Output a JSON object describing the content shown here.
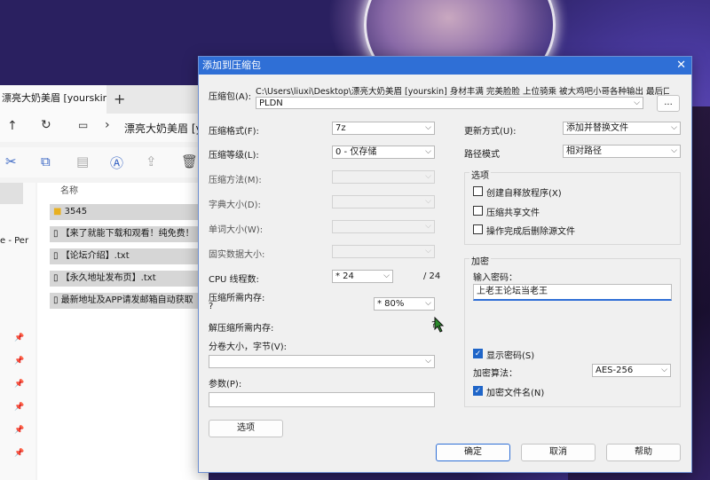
{
  "explorer": {
    "tab_title": "漂亮大奶美眉 [yourskin] 身材丰",
    "address": "漂亮大奶美眉 [y",
    "side_text": "e - Per",
    "column_name": "名称",
    "files": [
      "3545",
      "【来了就能下载和观看！纯免费！",
      "【论坛介绍】.txt",
      "【永久地址发布页】.txt",
      "最新地址及APP请发邮箱自动获取"
    ]
  },
  "dialog": {
    "title": "添加到压缩包",
    "close_glyph": "✕",
    "archive_label": "压缩包(A):",
    "archive_path": "C:\\Users\\liuxi\\Desktop\\漂亮大奶美眉 [yourskin] 身材丰满 完美脸脸 上位骑乘 被大鸡吧小哥各种输出 最后口爆\\",
    "archive_name": "PLDN",
    "browse_label": "...",
    "format_label": "压缩格式(F):",
    "format_value": "7z",
    "level_label": "压缩等级(L):",
    "level_value": "0 - 仅存储",
    "method_label": "压缩方法(M):",
    "dict_label": "字典大小(D):",
    "word_label": "单词大小(W):",
    "solid_label": "固实数据大小:",
    "threads_label": "CPU 线程数:",
    "threads_value": "* 24",
    "threads_max": "/ 24",
    "mem_label": "压缩所需内存:",
    "mem_q": "?",
    "mem_value": "* 80%",
    "demem_label": "解压缩所需内存:",
    "demem_q": "?",
    "split_label": "分卷大小，字节(V):",
    "params_label": "参数(P):",
    "options_button": "选项",
    "update_label": "更新方式(U):",
    "update_value": "添加并替换文件",
    "pathmode_label": "路径模式",
    "pathmode_value": "相对路径",
    "options_group": "选项",
    "opt_sfx": "创建自释放程序(X)",
    "opt_shared": "压缩共享文件",
    "opt_delete": "操作完成后删除源文件",
    "enc_group": "加密",
    "pwd_label": "输入密码：",
    "pwd_value": "上老王论坛当老王",
    "show_pwd": "显示密码(S)",
    "enc_method_label": "加密算法：",
    "enc_method_value": "AES-256",
    "enc_names": "加密文件名(N)",
    "ok": "确定",
    "cancel": "取消",
    "help": "帮助"
  }
}
